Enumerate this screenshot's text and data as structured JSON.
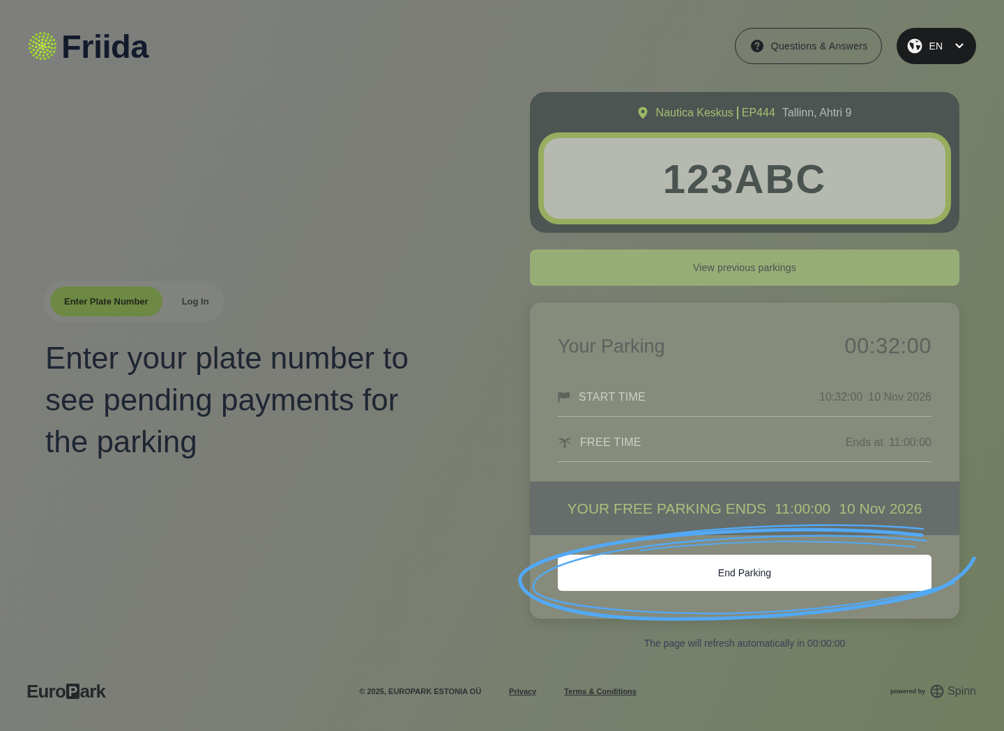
{
  "header": {
    "logo": "Friida",
    "help_button": "Questions & Answers",
    "language": "EN"
  },
  "intro": {
    "tabs": [
      {
        "label": "Enter Plate Number",
        "selected": true
      },
      {
        "label": "Log In",
        "selected": false
      }
    ],
    "heading": "Enter your plate number to see pending payments for the parking"
  },
  "plate_card": {
    "location_name": "Nautica Keskus",
    "location_code": "EP444",
    "address": "Tallinn, Ahtri 9",
    "plate_number": "123ABC"
  },
  "history_button": "View previous parkings",
  "parking_card": {
    "title": "Your Parking",
    "duration": "00:32:00",
    "rows": [
      {
        "kind": "start",
        "label": "START TIME",
        "value": [
          "10:32:00",
          "10 Nov 2026"
        ]
      },
      {
        "kind": "free",
        "label": "FREE TIME",
        "value": [
          "Ends at",
          "11:00:00"
        ]
      }
    ],
    "banner": [
      "YOUR FREE PARKING ENDS",
      "11:00:00",
      "10 Nov 2026"
    ],
    "end_button": "End Parking"
  },
  "refresh_notice": "The page will refresh automatically in 00:00:00",
  "footer": {
    "logo": {
      "before": "Euro",
      "boxed_letter": "P",
      "after": "ark"
    },
    "copyright": "© 2025, EUROPARK ESTONIA OÜ",
    "links": [
      "Privacy",
      "Terms & Conditions"
    ],
    "powered_by": "powered by",
    "brand": "Spinn"
  }
}
